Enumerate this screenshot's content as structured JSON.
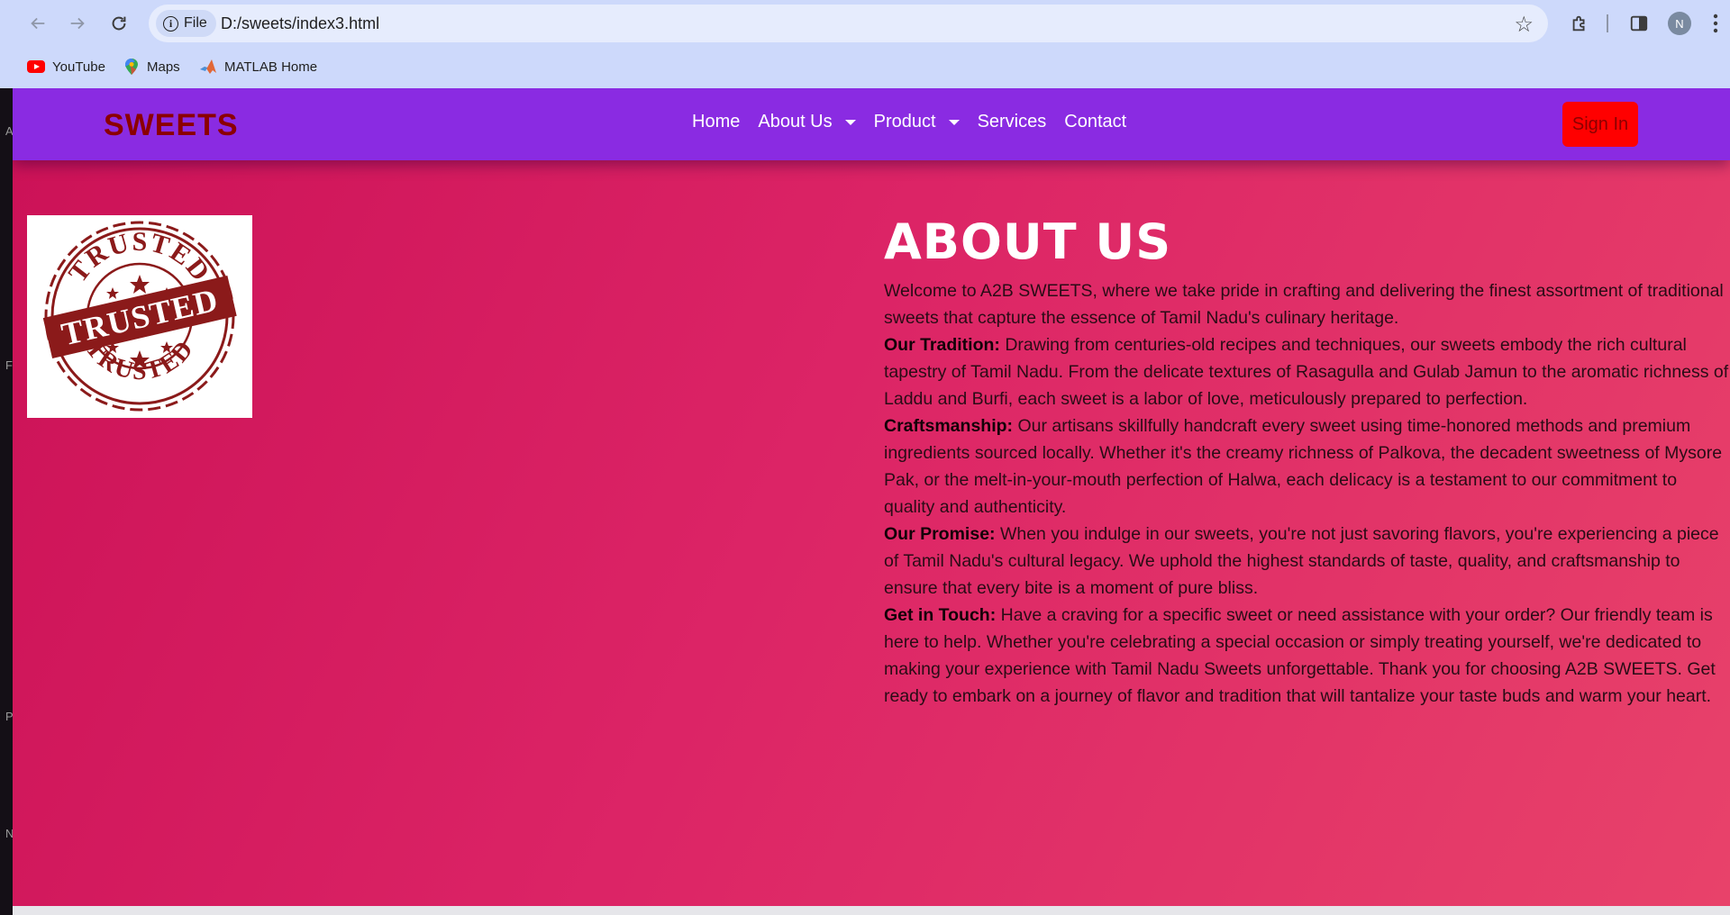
{
  "browser": {
    "file_chip": "File",
    "url": "D:/sweets/index3.html",
    "avatar_initial": "N",
    "bookmarks": [
      {
        "label": "YouTube",
        "icon": "youtube-icon"
      },
      {
        "label": "Maps",
        "icon": "maps-icon"
      },
      {
        "label": "MATLAB Home",
        "icon": "matlab-icon"
      }
    ]
  },
  "left_strip_letters": [
    "A",
    "F",
    "P",
    "N"
  ],
  "navbar": {
    "brand": "SWEETS",
    "menu": [
      {
        "label": "Home",
        "dropdown": false
      },
      {
        "label": "About Us",
        "dropdown": true
      },
      {
        "label": "Product",
        "dropdown": true
      },
      {
        "label": "Services",
        "dropdown": false
      },
      {
        "label": "Contact",
        "dropdown": false
      }
    ],
    "signin": "Sign In",
    "colors": {
      "bg": "#8a2be2",
      "brand": "#8b0000",
      "signin_bg": "#ff0000"
    }
  },
  "hero": {
    "badge_icon": "trusted-stamp-icon",
    "stamp": {
      "arc_top": "TRUSTED",
      "banner": "TRUSTED",
      "arc_bottom": "TRUSTED"
    }
  },
  "about": {
    "title": "ABOUT US",
    "intro": "Welcome to A2B SWEETS, where we take pride in crafting and delivering the finest assortment of traditional sweets that capture the essence of Tamil Nadu's culinary heritage.",
    "sections": [
      {
        "heading": "Our Tradition:",
        "text": " Drawing from centuries-old recipes and techniques, our sweets embody the rich cultural tapestry of Tamil Nadu. From the delicate textures of Rasagulla and Gulab Jamun to the aromatic richness of Laddu and Burfi, each sweet is a labor of love, meticulously prepared to perfection."
      },
      {
        "heading": "Craftsmanship:",
        "text": " Our artisans skillfully handcraft every sweet using time-honored methods and premium ingredients sourced locally. Whether it's the creamy richness of Palkova, the decadent sweetness of Mysore Pak, or the melt-in-your-mouth perfection of Halwa, each delicacy is a testament to our commitment to quality and authenticity."
      },
      {
        "heading": "Our Promise:",
        "text": " When you indulge in our sweets, you're not just savoring flavors, you're experiencing a piece of Tamil Nadu's cultural legacy. We uphold the highest standards of taste, quality, and craftsmanship to ensure that every bite is a moment of pure bliss."
      },
      {
        "heading": "Get in Touch:",
        "text": " Have a craving for a specific sweet or need assistance with your order? Our friendly team is here to help. Whether you're celebrating a special occasion or simply treating yourself, we're dedicated to making your experience with Tamil Nadu Sweets unforgettable. Thank you for choosing A2B SWEETS. Get ready to embark on a journey of flavor and tradition that will tantalize your taste buds and warm your heart."
      }
    ]
  }
}
